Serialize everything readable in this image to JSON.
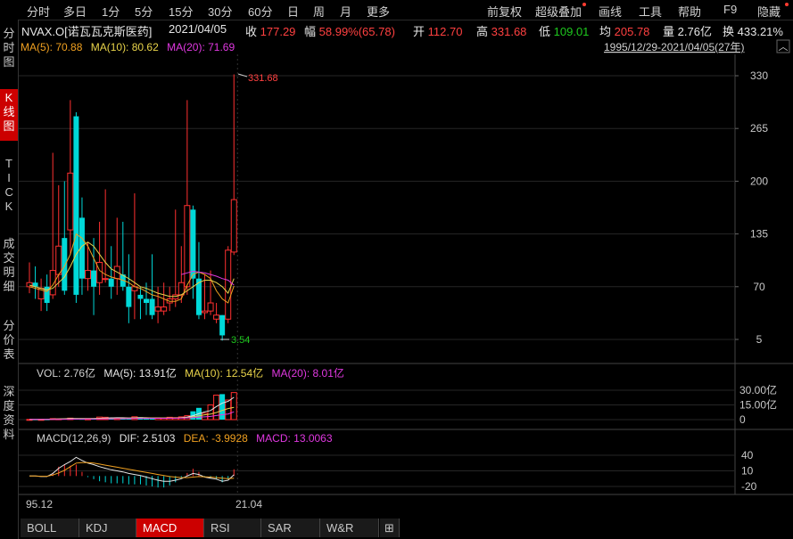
{
  "toolbar": {
    "items": [
      "分时",
      "多日",
      "1分",
      "5分",
      "15分",
      "30分",
      "60分",
      "日",
      "周",
      "月",
      "更多"
    ],
    "right_items": [
      "前复权",
      "超级叠加",
      "画线",
      "工具",
      "帮助",
      "F9",
      "隐藏"
    ]
  },
  "left_tabs": [
    "分时图",
    "K线图",
    "TICK",
    "成交明细",
    "分价表",
    "深度资料"
  ],
  "info": {
    "name": "NVAX.O[诺瓦瓦克斯医药]",
    "date": "2021/04/05",
    "close_label": "收",
    "close": "177.29",
    "range_label": "幅",
    "range": "58.99%(65.78)",
    "open_label": "开",
    "open": "112.70",
    "high_label": "高",
    "high": "331.68",
    "low_label": "低",
    "low": "109.01",
    "avg_label": "均",
    "avg": "205.78",
    "vol_label": "量",
    "vol": "2.76亿",
    "turn_label": "换",
    "turn": "433.21%"
  },
  "ma_line": {
    "ma5": "MA(5): 70.88",
    "ma10": "MA(10): 80.62",
    "ma20": "MA(20): 71.69"
  },
  "date_range": "1995/12/29-2021/04/05(27年)",
  "annotations": {
    "high": "331.68",
    "low": "3.54"
  },
  "vol_line": {
    "vol": "VOL: 2.76亿",
    "ma5": "MA(5): 13.91亿",
    "ma10": "MA(10): 12.54亿",
    "ma20": "MA(20): 8.01亿"
  },
  "macd_line": {
    "title": "MACD(12,26,9)",
    "dif": "DIF: 2.5103",
    "dea": "DEA: -3.9928",
    "macd": "MACD: 13.0063"
  },
  "price_axis": [
    "330",
    "265",
    "200",
    "135",
    "70",
    "5"
  ],
  "vol_axis": [
    "30.00亿",
    "15.00亿",
    "0"
  ],
  "macd_axis": [
    "40",
    "10",
    "-20"
  ],
  "x_labels": [
    "95.12",
    "21.04"
  ],
  "bottom_tabs": [
    "BOLL",
    "KDJ",
    "MACD",
    "RSI",
    "SAR",
    "W&R"
  ],
  "colors": {
    "up": "#ff3030",
    "down": "#00d8d8",
    "ma5": "#ffffff",
    "ma10": "#e8d34a",
    "ma20": "#e038e0",
    "grid": "#262626"
  },
  "chart_data": {
    "type": "candlestick",
    "ylim": [
      5,
      330
    ],
    "candles": [
      {
        "o": 70,
        "c": 75,
        "h": 100,
        "l": 62,
        "up": true
      },
      {
        "o": 75,
        "c": 70,
        "h": 95,
        "l": 55,
        "up": false
      },
      {
        "o": 55,
        "c": 68,
        "h": 80,
        "l": 40,
        "up": true
      },
      {
        "o": 70,
        "c": 50,
        "h": 85,
        "l": 40,
        "up": false
      },
      {
        "o": 60,
        "c": 90,
        "h": 235,
        "l": 55,
        "up": true
      },
      {
        "o": 85,
        "c": 120,
        "h": 195,
        "l": 70,
        "up": true
      },
      {
        "o": 130,
        "c": 65,
        "h": 200,
        "l": 60,
        "up": false
      },
      {
        "o": 140,
        "c": 210,
        "h": 300,
        "l": 110,
        "up": true
      },
      {
        "o": 280,
        "c": 60,
        "h": 285,
        "l": 50,
        "up": false
      },
      {
        "o": 155,
        "c": 80,
        "h": 180,
        "l": 60,
        "up": false
      },
      {
        "o": 80,
        "c": 90,
        "h": 125,
        "l": 65,
        "up": true
      },
      {
        "o": 90,
        "c": 70,
        "h": 130,
        "l": 35,
        "up": false
      },
      {
        "o": 75,
        "c": 100,
        "h": 150,
        "l": 60,
        "up": true
      },
      {
        "o": 80,
        "c": 80,
        "h": 190,
        "l": 75,
        "up": true
      },
      {
        "o": 80,
        "c": 70,
        "h": 120,
        "l": 55,
        "up": false
      },
      {
        "o": 80,
        "c": 95,
        "h": 155,
        "l": 60,
        "up": true
      },
      {
        "o": 85,
        "c": 70,
        "h": 150,
        "l": 65,
        "up": false
      },
      {
        "o": 70,
        "c": 45,
        "h": 110,
        "l": 25,
        "up": false
      },
      {
        "o": 65,
        "c": 70,
        "h": 185,
        "l": 30,
        "up": true
      },
      {
        "o": 60,
        "c": 55,
        "h": 70,
        "l": 30,
        "up": false
      },
      {
        "o": 55,
        "c": 50,
        "h": 75,
        "l": 35,
        "up": false
      },
      {
        "o": 55,
        "c": 35,
        "h": 110,
        "l": 30,
        "up": false
      },
      {
        "o": 40,
        "c": 45,
        "h": 70,
        "l": 25,
        "up": true
      },
      {
        "o": 40,
        "c": 45,
        "h": 75,
        "l": 35,
        "up": true
      },
      {
        "o": 50,
        "c": 55,
        "h": 70,
        "l": 40,
        "up": true
      },
      {
        "o": 55,
        "c": 60,
        "h": 165,
        "l": 45,
        "up": true
      },
      {
        "o": 60,
        "c": 75,
        "h": 120,
        "l": 50,
        "up": true
      },
      {
        "o": 70,
        "c": 170,
        "h": 300,
        "l": 60,
        "up": true
      },
      {
        "o": 165,
        "c": 80,
        "h": 170,
        "l": 55,
        "up": false
      },
      {
        "o": 80,
        "c": 35,
        "h": 125,
        "l": 30,
        "up": false
      },
      {
        "o": 38,
        "c": 40,
        "h": 85,
        "l": 30,
        "up": true
      },
      {
        "o": 40,
        "c": 50,
        "h": 90,
        "l": 35,
        "up": true
      },
      {
        "o": 30,
        "c": 35,
        "h": 50,
        "l": 25,
        "up": true
      },
      {
        "o": 35,
        "c": 10,
        "h": 35,
        "l": 3.54,
        "up": false
      },
      {
        "o": 30,
        "c": 115,
        "h": 120,
        "l": 25,
        "up": true
      },
      {
        "o": 112.7,
        "c": 177.29,
        "h": 331.68,
        "l": 109.01,
        "up": true
      }
    ],
    "ma5": [
      70,
      68,
      66,
      64,
      72,
      85,
      95,
      110,
      135,
      130,
      120,
      105,
      90,
      85,
      82,
      80,
      78,
      75,
      70,
      68,
      64,
      60,
      58,
      55,
      52,
      52,
      55,
      72,
      85,
      88,
      85,
      80,
      65,
      55,
      50,
      71
    ],
    "ma10": [
      72,
      70,
      68,
      66,
      68,
      75,
      82,
      95,
      110,
      120,
      125,
      120,
      110,
      100,
      92,
      88,
      84,
      80,
      75,
      70,
      68,
      65,
      62,
      60,
      58,
      58,
      60,
      65,
      70,
      75,
      78,
      78,
      75,
      70,
      62,
      80
    ],
    "ma20": [
      null,
      null,
      null,
      null,
      null,
      null,
      null,
      null,
      null,
      null,
      null,
      null,
      null,
      null,
      null,
      null,
      null,
      null,
      null,
      null,
      null,
      null,
      null,
      null,
      null,
      null,
      85,
      87,
      89,
      88,
      87,
      85,
      83,
      80,
      78,
      72
    ],
    "volume": [
      0.2,
      0.3,
      0.2,
      0.3,
      1.0,
      0.8,
      1.2,
      1.5,
      1.0,
      0.8,
      0.7,
      1.1,
      2.6,
      2.4,
      1.5,
      1.7,
      1.6,
      0.9,
      2.9,
      2.5,
      1.5,
      1.1,
      1.6,
      1.4,
      2.4,
      2.0,
      2.8,
      4.0,
      8.5,
      12.0,
      6.5,
      15.0,
      25.0,
      26.0,
      20.0,
      27.6
    ],
    "vol_ma5": [
      0.3,
      0.3,
      0.3,
      0.4,
      0.5,
      0.7,
      0.9,
      1.1,
      1.2,
      1.2,
      1.1,
      1.1,
      1.4,
      1.6,
      1.8,
      1.9,
      1.9,
      1.7,
      1.8,
      2.0,
      1.9,
      1.7,
      1.7,
      1.6,
      1.8,
      1.7,
      2.0,
      2.6,
      4.0,
      6.0,
      7.9,
      9.3,
      13.4,
      16.9,
      18.6,
      22.8
    ],
    "vol_ma10": [
      0.3,
      0.3,
      0.3,
      0.3,
      0.4,
      0.5,
      0.6,
      0.7,
      0.8,
      0.9,
      0.9,
      1.0,
      1.1,
      1.2,
      1.3,
      1.4,
      1.5,
      1.5,
      1.6,
      1.7,
      1.7,
      1.7,
      1.7,
      1.7,
      1.8,
      1.8,
      1.9,
      2.0,
      2.8,
      3.9,
      4.9,
      5.6,
      7.3,
      9.4,
      11.3,
      12.5
    ],
    "vol_ma20": [
      0.2,
      0.2,
      0.2,
      0.2,
      0.3,
      0.3,
      0.4,
      0.4,
      0.5,
      0.5,
      0.6,
      0.6,
      0.7,
      0.8,
      0.9,
      1.0,
      1.0,
      1.1,
      1.2,
      1.3,
      1.3,
      1.4,
      1.4,
      1.4,
      1.5,
      1.5,
      1.6,
      1.7,
      2.1,
      2.5,
      2.8,
      3.3,
      4.2,
      5.0,
      5.7,
      8.0
    ],
    "macd_dif": [
      0,
      0,
      -1,
      -1,
      5,
      15,
      22,
      28,
      36,
      30,
      25,
      22,
      18,
      15,
      12,
      10,
      8,
      5,
      3,
      1,
      -2,
      -5,
      -8,
      -10,
      -10,
      -8,
      -5,
      0,
      5,
      3,
      -2,
      -4,
      -6,
      -10,
      -8,
      2.5
    ],
    "macd_dea": [
      0,
      0,
      -0.5,
      -0.5,
      2,
      6,
      11,
      18,
      25,
      26,
      26,
      25,
      23,
      21,
      19,
      17,
      15,
      13,
      11,
      9,
      7,
      5,
      3,
      1,
      -1,
      -2,
      -3,
      -3,
      -2,
      -1,
      -1.5,
      -2,
      -3,
      -4,
      -5,
      -4
    ],
    "macd_hist": [
      0,
      0,
      -1,
      -1,
      6,
      18,
      22,
      20,
      22,
      8,
      -2,
      -6,
      -10,
      -12,
      -14,
      -14,
      -14,
      -16,
      -16,
      -16,
      -18,
      -20,
      -22,
      -22,
      -18,
      -12,
      -4,
      6,
      14,
      8,
      -1,
      -4,
      -6,
      -12,
      -6,
      13
    ]
  }
}
